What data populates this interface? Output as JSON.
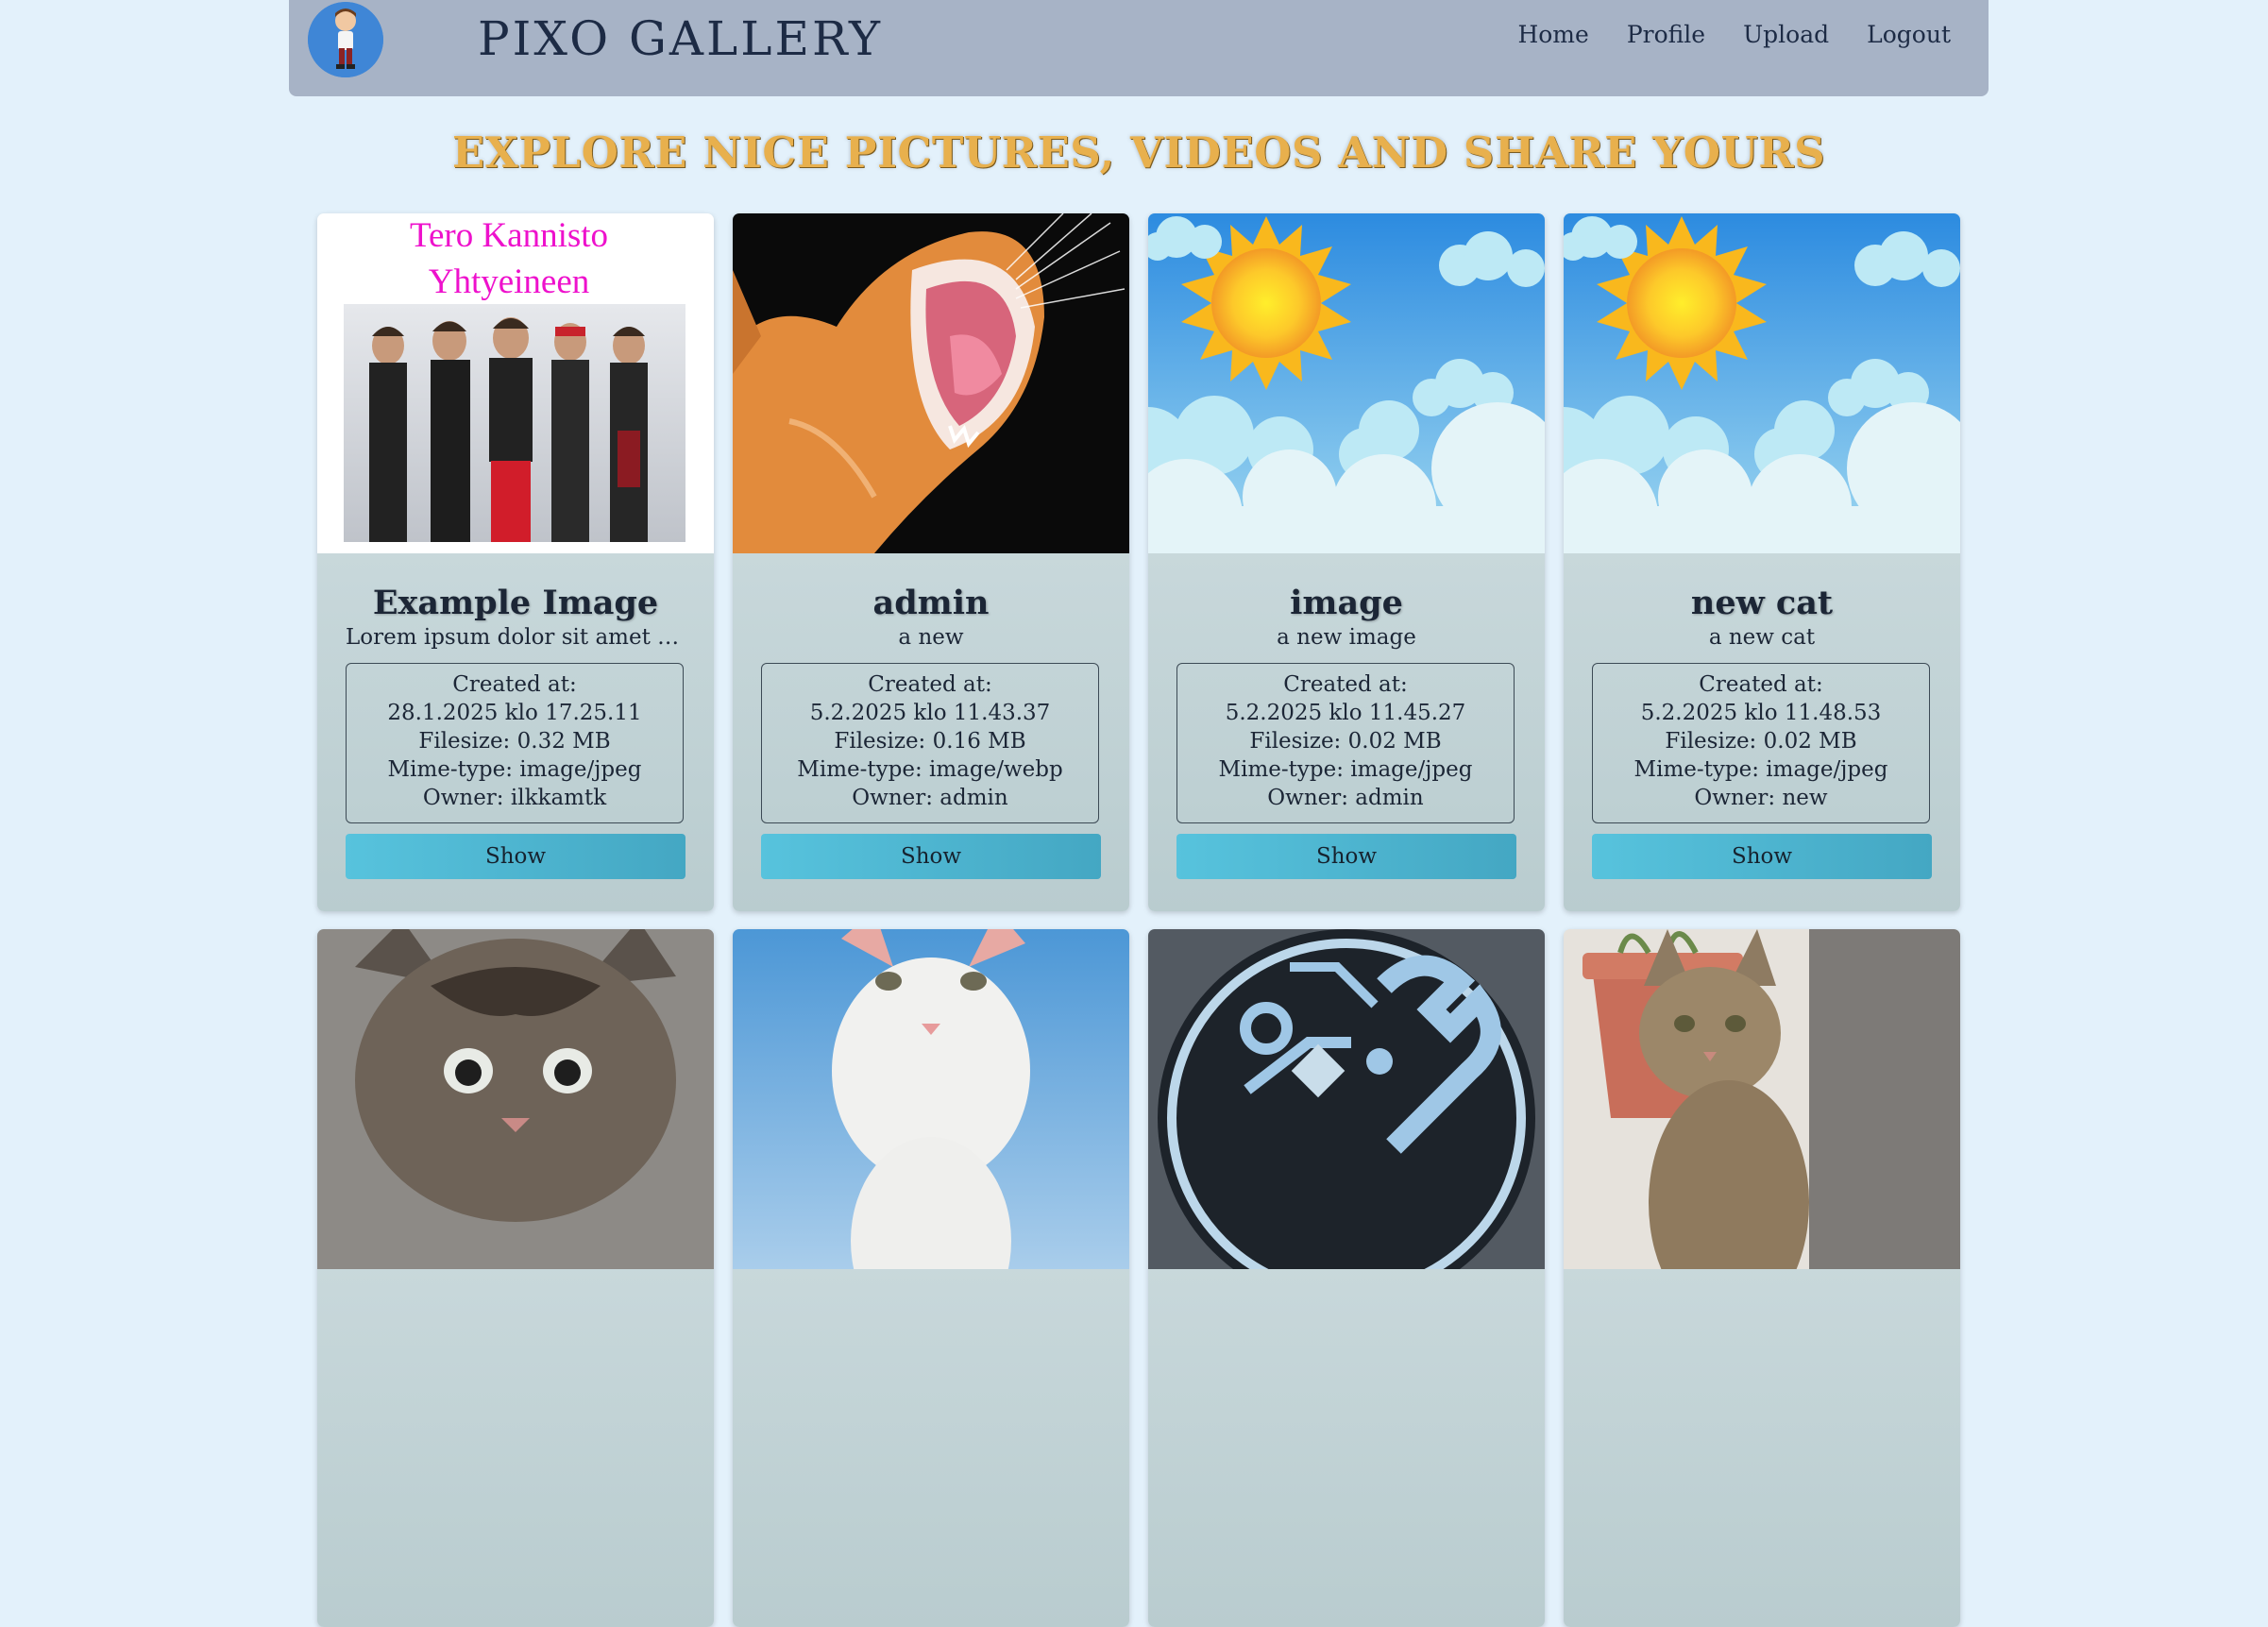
{
  "header": {
    "brand": "PIXO GALLERY",
    "nav": [
      "Home",
      "Profile",
      "Upload",
      "Logout"
    ]
  },
  "hero_title": "EXPLORE NICE PICTURES, VIDEOS AND SHARE YOURS",
  "labels": {
    "created": "Created at:",
    "filesize_prefix": "Filesize: ",
    "mime_prefix": "Mime-type: ",
    "owner_prefix": "Owner: ",
    "show": "Show"
  },
  "cards": [
    {
      "image_text": [
        "Tero Kannisto",
        "Yhtyeineen"
      ],
      "title": "Example Image",
      "description": "Lorem ipsum dolor sit amet consectetur",
      "created": "28.1.2025 klo 17.25.11",
      "filesize": "Filesize: 0.32 MB",
      "mime": "Mime-type: image/jpeg",
      "owner": "Owner: ilkkamtk"
    },
    {
      "title": "admin",
      "description": "a new",
      "created": "5.2.2025 klo 11.43.37",
      "filesize": "Filesize: 0.16 MB",
      "mime": "Mime-type: image/webp",
      "owner": "Owner: admin"
    },
    {
      "title": "image",
      "description": "a new image",
      "created": "5.2.2025 klo 11.45.27",
      "filesize": "Filesize: 0.02 MB",
      "mime": "Mime-type: image/jpeg",
      "owner": "Owner: admin"
    },
    {
      "title": "new cat",
      "description": "a new cat",
      "created": "5.2.2025 klo 11.48.53",
      "filesize": "Filesize: 0.02 MB",
      "mime": "Mime-type: image/jpeg",
      "owner": "Owner: new"
    }
  ],
  "colors": {
    "background": "#e3f1fb",
    "header": "#a7b3c6",
    "hero_title": "#e8b04d",
    "button": "#4fb8d2"
  }
}
